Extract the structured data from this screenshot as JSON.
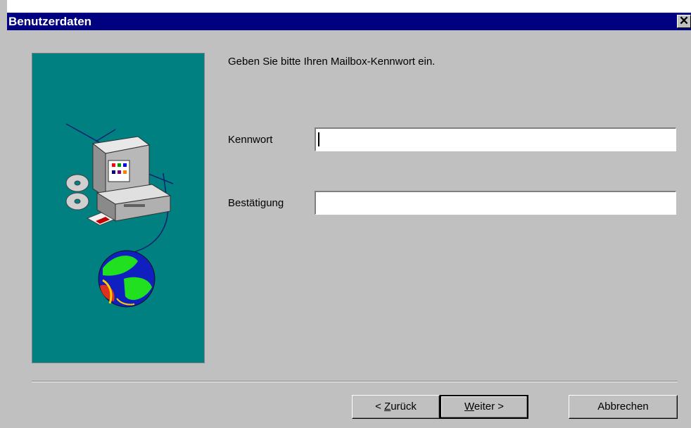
{
  "window": {
    "title": "Benutzerdaten",
    "close_symbol": "✕"
  },
  "wizard": {
    "instruction": "Geben Sie bitte Ihren Mailbox-Kennwort ein.",
    "password_label": "Kennwort",
    "password_value": "",
    "confirm_label": "Bestätigung",
    "confirm_value": ""
  },
  "buttons": {
    "back_prefix": "< ",
    "back_hotkey": "Z",
    "back_rest": "urück",
    "next_hotkey": "W",
    "next_rest": "eiter >",
    "cancel": "Abbrechen"
  },
  "colors": {
    "titlebar": "#000080",
    "face": "#c0c0c0",
    "illustration_bg": "#008080"
  },
  "icons": [
    "computer-icon",
    "cd-icon",
    "floppy-icon",
    "globe-icon"
  ]
}
